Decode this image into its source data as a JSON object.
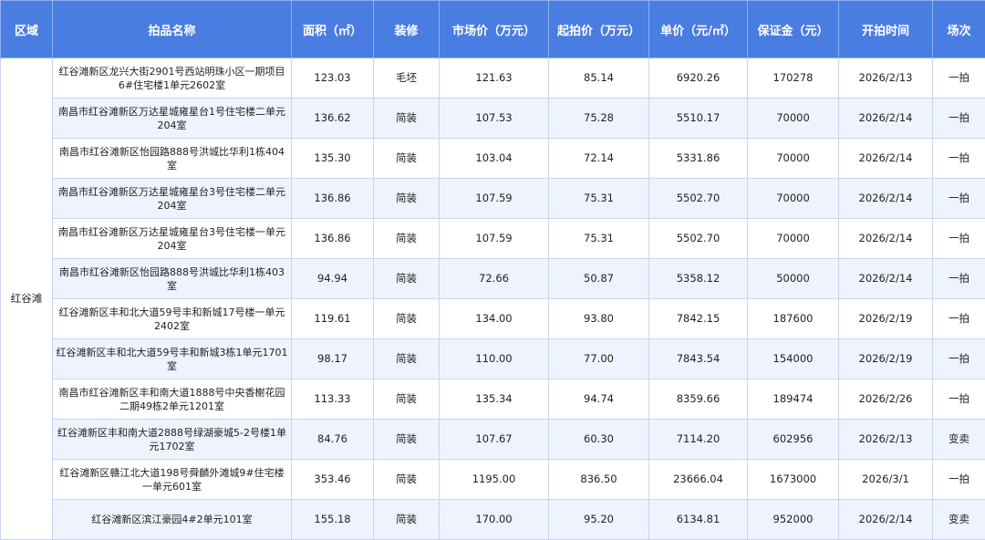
{
  "headers": [
    "区域",
    "拍品名称",
    "面积（㎡）",
    "装修",
    "市场价（万元）",
    "起拍价（万元）",
    "单价（元/㎡）",
    "保证金（元）",
    "开拍时间",
    "场次"
  ],
  "region": "红谷滩",
  "rows": [
    [
      "红谷滩新区龙兴大街2901号西站明珠小区一期项目6#住宅楼1单元2602室",
      "123.03",
      "毛坯",
      "121.63",
      "85.14",
      "6920.26",
      "170278",
      "2026/2/13",
      "一拍"
    ],
    [
      "南昌市红谷滩新区万达星城雍星台1号住宅楼二单元204室",
      "136.62",
      "简装",
      "107.53",
      "75.28",
      "5510.17",
      "70000",
      "2026/2/14",
      "一拍"
    ],
    [
      "南昌市红谷滩新区怡园路888号洪城比华利1栋404室",
      "135.30",
      "简装",
      "103.04",
      "72.14",
      "5331.86",
      "70000",
      "2026/2/14",
      "一拍"
    ],
    [
      "南昌市红谷滩新区万达星城雍星台3号住宅楼二单元204室",
      "136.86",
      "简装",
      "107.59",
      "75.31",
      "5502.70",
      "70000",
      "2026/2/14",
      "一拍"
    ],
    [
      "南昌市红谷滩新区万达星城雍星台3号住宅楼一单元204室",
      "136.86",
      "简装",
      "107.59",
      "75.31",
      "5502.70",
      "70000",
      "2026/2/14",
      "一拍"
    ],
    [
      "南昌市红谷滩新区怡园路888号洪城比华利1栋403室",
      "94.94",
      "简装",
      "72.66",
      "50.87",
      "5358.12",
      "50000",
      "2026/2/14",
      "一拍"
    ],
    [
      "红谷滩新区丰和北大道59号丰和新城17号楼一单元2402室",
      "119.61",
      "简装",
      "134.00",
      "93.80",
      "7842.15",
      "187600",
      "2026/2/19",
      "一拍"
    ],
    [
      "红谷滩新区丰和北大道59号丰和新城3栋1单元1701室",
      "98.17",
      "简装",
      "110.00",
      "77.00",
      "7843.54",
      "154000",
      "2026/2/19",
      "一拍"
    ],
    [
      "南昌市红谷滩新区丰和南大道1888号中央香榭花园二期49栋2单元1201室",
      "113.33",
      "简装",
      "135.34",
      "94.74",
      "8359.66",
      "189474",
      "2026/2/26",
      "一拍"
    ],
    [
      "红谷滩新区丰和南大道2888号绿湖豪城5-2号楼1单元1702室",
      "84.76",
      "简装",
      "107.67",
      "60.30",
      "7114.20",
      "602956",
      "2026/2/13",
      "变卖"
    ],
    [
      "红谷滩新区赣江北大道198号舜麟外滩城9#住宅楼一单元601室",
      "353.46",
      "简装",
      "1195.00",
      "836.50",
      "23666.04",
      "1673000",
      "2026/3/1",
      "一拍"
    ],
    [
      "红谷滩新区滨江豪园4#2单元101室",
      "155.18",
      "简装",
      "170.00",
      "95.20",
      "6134.81",
      "952000",
      "2026/2/14",
      "变卖"
    ]
  ]
}
